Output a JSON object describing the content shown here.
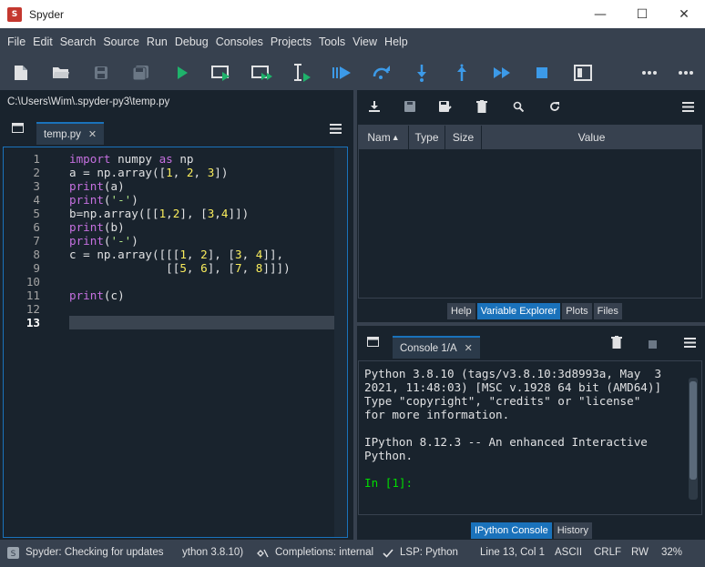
{
  "window": {
    "title": "Spyder",
    "app_icon": "spyder-icon",
    "minimize": "—",
    "maximize": "☐",
    "close": "✕"
  },
  "menu": [
    "File",
    "Edit",
    "Search",
    "Source",
    "Run",
    "Debug",
    "Consoles",
    "Projects",
    "Tools",
    "View",
    "Help"
  ],
  "toolbar": {
    "icons": [
      "new-file-icon",
      "open-file-icon",
      "save-icon",
      "save-all-icon",
      "run-icon",
      "run-cell-icon",
      "run-cell-advance-icon",
      "run-selection-icon",
      "debug-icon",
      "step-over-icon",
      "step-into-icon",
      "step-return-icon",
      "continue-icon",
      "stop-icon",
      "maximize-pane-icon",
      "more-options-icon",
      "more-options-icon"
    ],
    "accent": "#1a72bb"
  },
  "editor": {
    "path": "C:\\Users\\Wim\\.spyder-py3\\temp.py",
    "tab_label": "temp.py",
    "tab_close": "✕",
    "menu_icon": "hamburger-icon",
    "current_line": 13,
    "lines": [
      {
        "n": "1",
        "t": [
          [
            "kw",
            "import"
          ],
          [
            "txt",
            " numpy "
          ],
          [
            "kw",
            "as"
          ],
          [
            "txt",
            " np"
          ]
        ]
      },
      {
        "n": "2",
        "t": [
          [
            "txt",
            "a = np.array(["
          ],
          [
            "num",
            "1"
          ],
          [
            "txt",
            ", "
          ],
          [
            "num",
            "2"
          ],
          [
            "txt",
            ", "
          ],
          [
            "num",
            "3"
          ],
          [
            "txt",
            "])"
          ]
        ]
      },
      {
        "n": "3",
        "t": [
          [
            "fn",
            "print"
          ],
          [
            "txt",
            "(a)"
          ]
        ]
      },
      {
        "n": "4",
        "t": [
          [
            "fn",
            "print"
          ],
          [
            "txt",
            "("
          ],
          [
            "str",
            "'-'"
          ],
          [
            "txt",
            ")"
          ]
        ]
      },
      {
        "n": "5",
        "t": [
          [
            "txt",
            "b=np.array([["
          ],
          [
            "num",
            "1"
          ],
          [
            "txt",
            ","
          ],
          [
            "num",
            "2"
          ],
          [
            "txt",
            "], ["
          ],
          [
            "num",
            "3"
          ],
          [
            "txt",
            ","
          ],
          [
            "num",
            "4"
          ],
          [
            "txt",
            "]])"
          ]
        ]
      },
      {
        "n": "6",
        "t": [
          [
            "fn",
            "print"
          ],
          [
            "txt",
            "(b)"
          ]
        ]
      },
      {
        "n": "7",
        "t": [
          [
            "fn",
            "print"
          ],
          [
            "txt",
            "("
          ],
          [
            "str",
            "'-'"
          ],
          [
            "txt",
            ")"
          ]
        ]
      },
      {
        "n": "8",
        "t": [
          [
            "txt",
            "c = np.array([[["
          ],
          [
            "num",
            "1"
          ],
          [
            "txt",
            ", "
          ],
          [
            "num",
            "2"
          ],
          [
            "txt",
            "], ["
          ],
          [
            "num",
            "3"
          ],
          [
            "txt",
            ", "
          ],
          [
            "num",
            "4"
          ],
          [
            "txt",
            "]],"
          ]
        ]
      },
      {
        "n": "9",
        "t": [
          [
            "txt",
            "              [["
          ],
          [
            "num",
            "5"
          ],
          [
            "txt",
            ", "
          ],
          [
            "num",
            "6"
          ],
          [
            "txt",
            "], ["
          ],
          [
            "num",
            "7"
          ],
          [
            "txt",
            ", "
          ],
          [
            "num",
            "8"
          ],
          [
            "txt",
            "]]])"
          ]
        ]
      },
      {
        "n": "10",
        "t": []
      },
      {
        "n": "11",
        "t": [
          [
            "fn",
            "print"
          ],
          [
            "txt",
            "(c)"
          ]
        ]
      },
      {
        "n": "12",
        "t": []
      },
      {
        "n": "13",
        "t": []
      }
    ]
  },
  "variable_explorer": {
    "tool_icons": [
      "import-data-icon",
      "save-data-icon",
      "save-data-as-icon",
      "remove-all-icon",
      "search-icon",
      "refresh-icon"
    ],
    "menu_icon": "hamburger-icon",
    "columns": [
      "Nam",
      "Type",
      "Size",
      "Value"
    ],
    "sort_indicator": "▲",
    "pane_tabs": [
      "Help",
      "Variable Explorer",
      "Plots",
      "Files"
    ],
    "active_tab": "Variable Explorer"
  },
  "console": {
    "tab_label": "Console 1/A",
    "tab_close": "✕",
    "output": [
      "Python 3.8.10 (tags/v3.8.10:3d8993a, May  3",
      "2021, 11:48:03) [MSC v.1928 64 bit (AMD64)]",
      "Type \"copyright\", \"credits\" or \"license\"",
      "for more information.",
      "",
      "IPython 8.12.3 -- An enhanced Interactive",
      "Python.",
      ""
    ],
    "prompt": "In [1]:",
    "pane_tabs": [
      "IPython Console",
      "History"
    ],
    "active_tab": "IPython Console"
  },
  "statusbar": {
    "update_text": "Spyder: Checking for updates",
    "python_env": "ython 3.8.10)",
    "completions": "Completions: internal",
    "lsp": "LSP: Python",
    "position": "Line 13, Col 1",
    "encoding": "ASCII",
    "eol": "CRLF",
    "rw": "RW",
    "memory": "32%"
  }
}
